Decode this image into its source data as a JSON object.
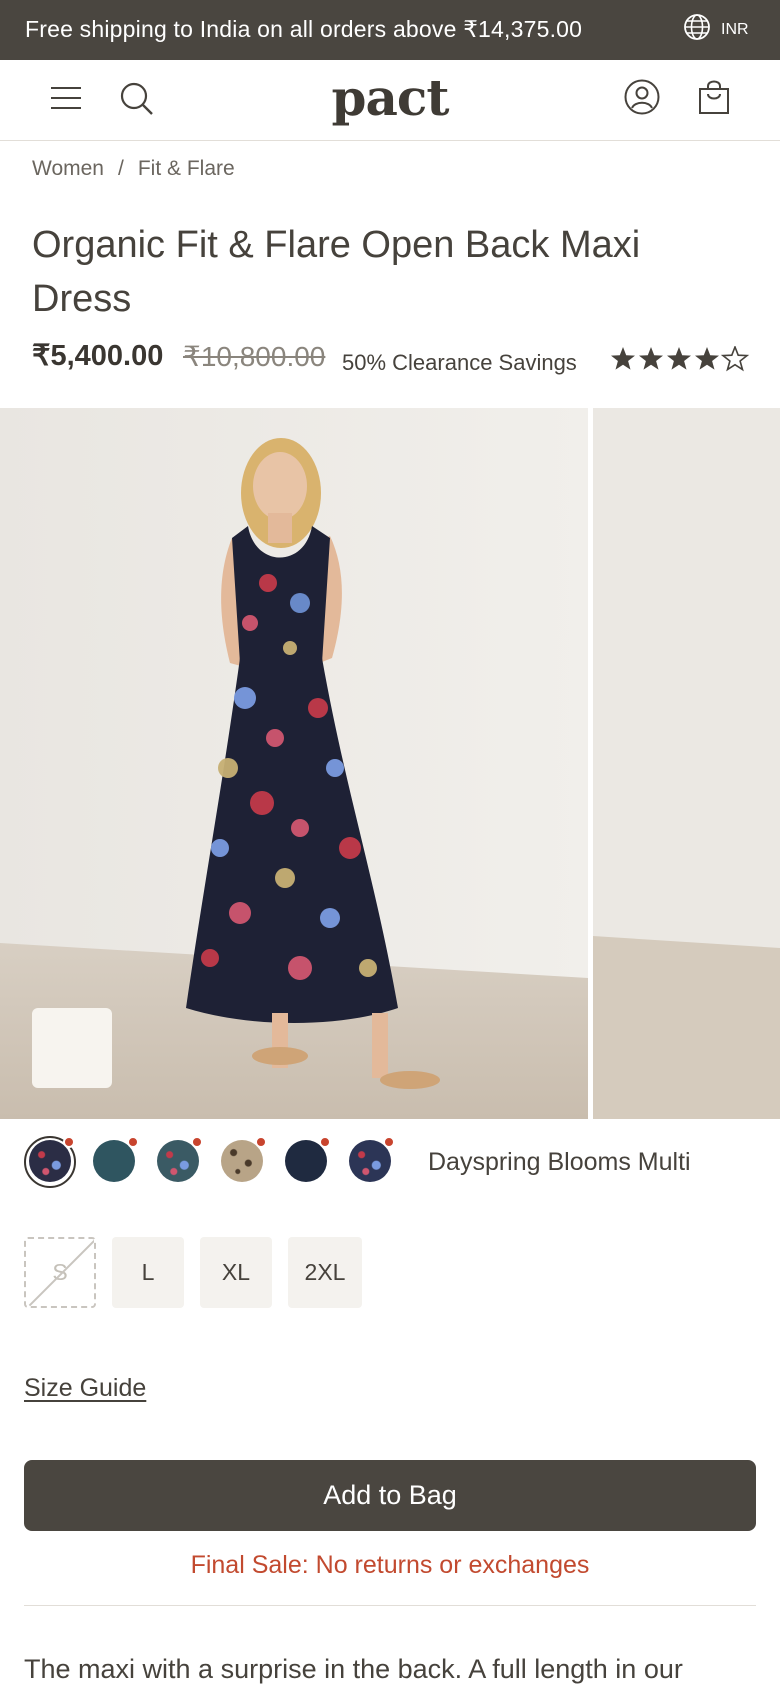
{
  "promo": {
    "text": "Free shipping to India on all orders above ₹14,375.00",
    "currency": "INR"
  },
  "header": {
    "logo": "pact"
  },
  "breadcrumb": {
    "items": [
      "Women",
      "Fit & Flare"
    ],
    "separator": "/"
  },
  "product": {
    "title": "Organic Fit & Flare Open Back Maxi Dress",
    "price": "₹5,400.00",
    "compare_price": "₹10,800.00",
    "savings": "50% Clearance Savings",
    "rating": 4.5,
    "rating_max": 5
  },
  "colors": {
    "selected_name": "Dayspring Blooms Multi",
    "swatches": [
      {
        "name": "dayspring-blooms-multi",
        "color": "#2b2d45"
      },
      {
        "name": "teal",
        "color": "#2f5560"
      },
      {
        "name": "teal-floral",
        "color": "#3a5a64"
      },
      {
        "name": "leopard",
        "color": "#b8a487"
      },
      {
        "name": "navy",
        "color": "#1f2a40"
      },
      {
        "name": "navy-white-floral",
        "color": "#2c3556"
      }
    ]
  },
  "sizes": {
    "items": [
      {
        "label": "S",
        "available": false
      },
      {
        "label": "L",
        "available": true
      },
      {
        "label": "XL",
        "available": true
      },
      {
        "label": "2XL",
        "available": true
      }
    ]
  },
  "size_guide_label": "Size Guide",
  "add_to_bag_label": "Add to Bag",
  "final_sale_text": "Final Sale: No returns or exchanges",
  "description_start": "The maxi with a surprise in the back. A full length in our",
  "colors_theme": {
    "primary_dark": "#4a4640",
    "sale_red": "#c24a2f",
    "swatch_dot": "#c8442e"
  }
}
